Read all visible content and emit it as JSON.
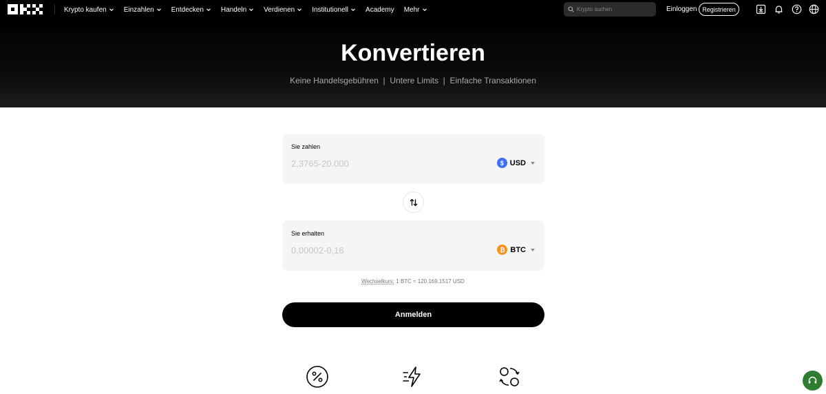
{
  "nav": {
    "menu": [
      {
        "label": "Krypto kaufen",
        "has_dropdown": true
      },
      {
        "label": "Einzahlen",
        "has_dropdown": true
      },
      {
        "label": "Entdecken",
        "has_dropdown": true
      },
      {
        "label": "Handeln",
        "has_dropdown": true
      },
      {
        "label": "Verdienen",
        "has_dropdown": true
      },
      {
        "label": "Institutionell",
        "has_dropdown": true
      },
      {
        "label": "Academy",
        "has_dropdown": false
      },
      {
        "label": "Mehr",
        "has_dropdown": true
      }
    ],
    "search_placeholder": "Krypto suchen",
    "login_label": "Einloggen",
    "register_label": "Registrieren",
    "icons": [
      "download-icon",
      "bell-icon",
      "help-icon",
      "globe-icon"
    ]
  },
  "hero": {
    "title": "Konvertieren",
    "subtitle": "Keine Handelsgebühren  |  Untere Limits  |  Einfache Transaktionen"
  },
  "converter": {
    "pay": {
      "label": "Sie zahlen",
      "placeholder": "2,3765-20.000",
      "currency": "USD",
      "coin_color": "#3b6ff5"
    },
    "receive": {
      "label": "Sie erhalten",
      "placeholder": "0,00002-0,16",
      "currency": "BTC",
      "coin_color": "#f7931a"
    },
    "rate_label": "Wechselkurs:",
    "rate_value": "1 BTC ≈ 120.169,1517 USD",
    "cta_label": "Anmelden"
  },
  "features": {
    "icons": [
      "percent-icon",
      "lightning-icon",
      "convert-circles-icon"
    ]
  },
  "colors": {
    "accent": "#000000",
    "support": "#2e7d32"
  }
}
